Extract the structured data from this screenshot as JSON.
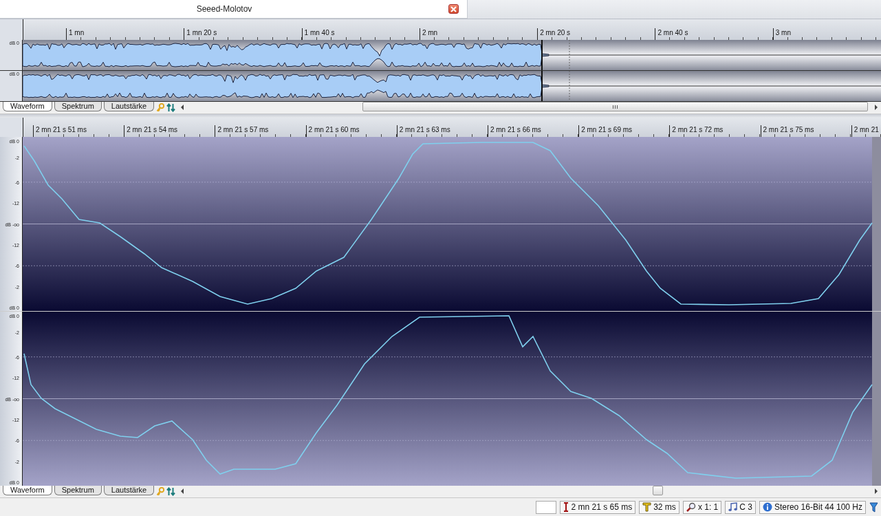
{
  "document_tab": {
    "title": "Seeed-Molotov"
  },
  "overview": {
    "ruler": [
      "1 mn",
      "1 mn 20 s",
      "1 mn 40 s",
      "2 mn",
      "2 mn 20 s",
      "2 mn 40 s",
      "3 mn"
    ],
    "channels": [
      {
        "label": "dB 0"
      },
      {
        "label": "dB 0"
      }
    ],
    "view_tabs": [
      {
        "label": "Waveform",
        "selected": true
      },
      {
        "label": "Spektrum",
        "selected": false
      },
      {
        "label": "Lautstärke",
        "selected": false
      }
    ]
  },
  "detail": {
    "ruler": [
      "2 mn 21 s 51 ms",
      "2 mn 21 s 54 ms",
      "2 mn 21 s 57 ms",
      "2 mn 21 s 60 ms",
      "2 mn 21 s 63 ms",
      "2 mn 21 s 66 ms",
      "2 mn 21 s 69 ms",
      "2 mn 21 s 72 ms",
      "2 mn 21 s 75 ms",
      "2 mn 21"
    ],
    "channels": [
      {
        "scale": [
          "dB 0",
          "-2",
          "-6",
          "-12",
          "dB -oo",
          "-12",
          "-6",
          "-2",
          "dB 0"
        ]
      },
      {
        "scale": [
          "dB 0",
          "-2",
          "-6",
          "-12",
          "dB -oo",
          "-12",
          "-6",
          "-2",
          "dB 0"
        ]
      }
    ],
    "view_tabs": [
      {
        "label": "Waveform",
        "selected": true
      },
      {
        "label": "Spektrum",
        "selected": false
      },
      {
        "label": "Lautstärke",
        "selected": false
      }
    ]
  },
  "status_bar": {
    "fields": [
      {
        "kind": "blank"
      },
      {
        "kind": "cursor",
        "text": "2 mn 21 s 65 ms"
      },
      {
        "kind": "length",
        "text": "32 ms"
      },
      {
        "kind": "zoom",
        "text": "x 1: 1"
      },
      {
        "kind": "note",
        "text": "C 3"
      },
      {
        "kind": "info",
        "text": "Stereo 16-Bit 44 100 Hz"
      }
    ]
  }
}
